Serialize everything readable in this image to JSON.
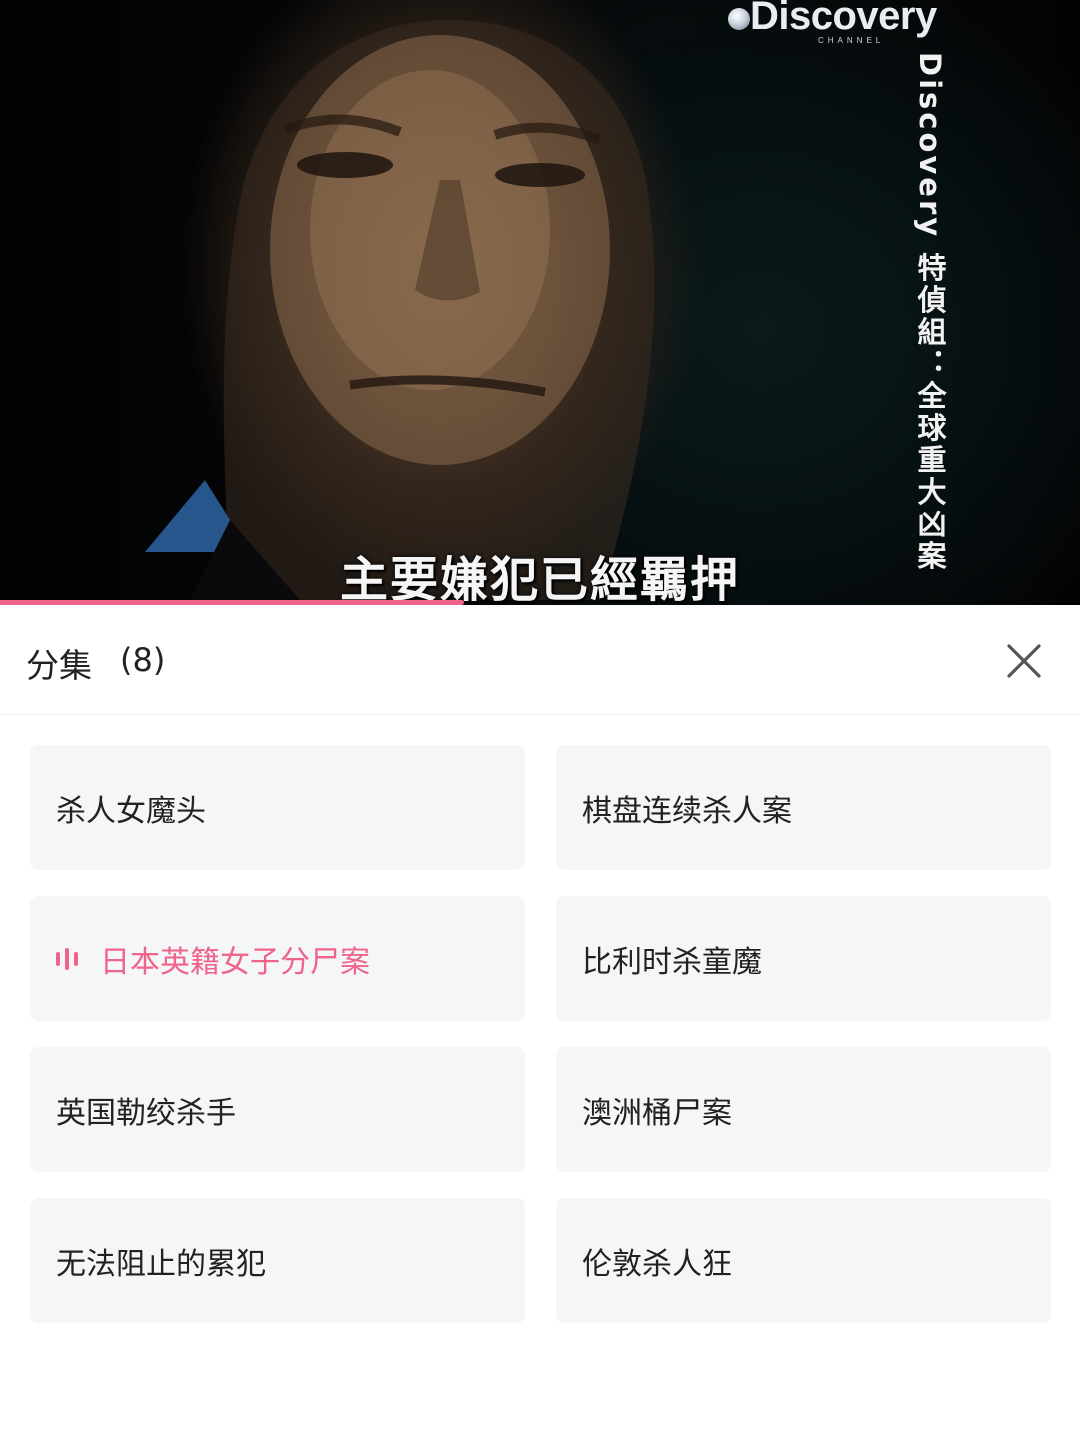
{
  "video": {
    "logo_text": "Discovery",
    "logo_subtext": "CHANNEL",
    "vertical_title": "Discovery 特偵組：全球重大凶案",
    "subtitle": "主要嫌犯已經羈押",
    "progress_fraction": 0.43,
    "accent_color": "#f0648a"
  },
  "panel": {
    "title": "分集",
    "count": "(8)",
    "close_icon": "close-icon"
  },
  "episodes": [
    {
      "label": "杀人女魔头",
      "active": false
    },
    {
      "label": "棋盘连续杀人案",
      "active": false
    },
    {
      "label": "日本英籍女子分尸案",
      "active": true
    },
    {
      "label": "比利时杀童魔",
      "active": false
    },
    {
      "label": "英国勒绞杀手",
      "active": false
    },
    {
      "label": "澳洲桶尸案",
      "active": false
    },
    {
      "label": "无法阻止的累犯",
      "active": false
    },
    {
      "label": "伦敦杀人狂",
      "active": false
    }
  ]
}
